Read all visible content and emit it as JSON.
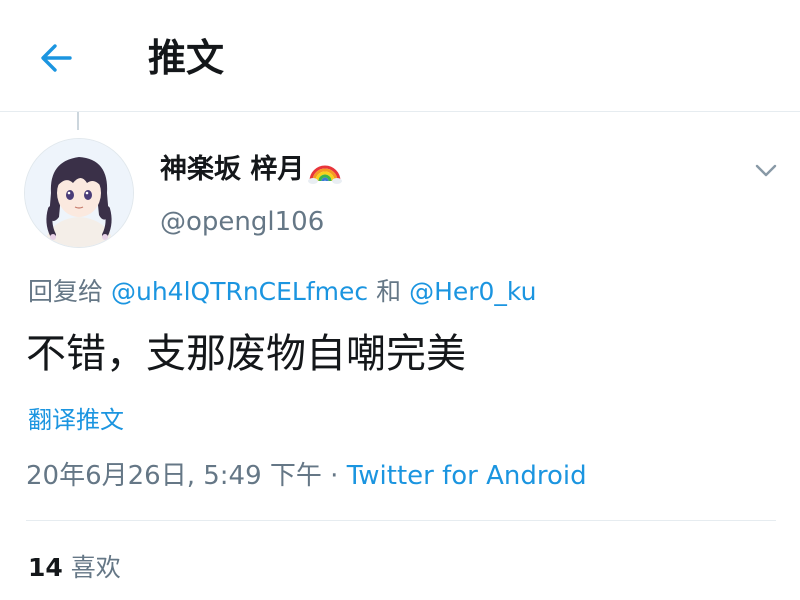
{
  "header": {
    "title": "推文",
    "back_icon": "arrow-left-icon"
  },
  "colors": {
    "accent": "#1b95e0",
    "secondary_text": "#657786",
    "primary_text": "#14171a",
    "divider": "#e6ecf0"
  },
  "tweet": {
    "author": {
      "name": "神楽坂 梓月",
      "emoji_icon": "rainbow-icon",
      "handle": "@opengl106"
    },
    "reply_prefix": "回复给",
    "reply_to": [
      "@uh4lQTRnCELfmec",
      "@Her0_ku"
    ],
    "reply_joiner": "和",
    "text": "不错，支那废物自嘲完美",
    "translate_label": "翻译推文",
    "timestamp": "20年6月26日, 5:49 下午",
    "separator": "·",
    "source": "Twitter for Android",
    "likes_count": "14",
    "likes_label": "喜欢"
  }
}
